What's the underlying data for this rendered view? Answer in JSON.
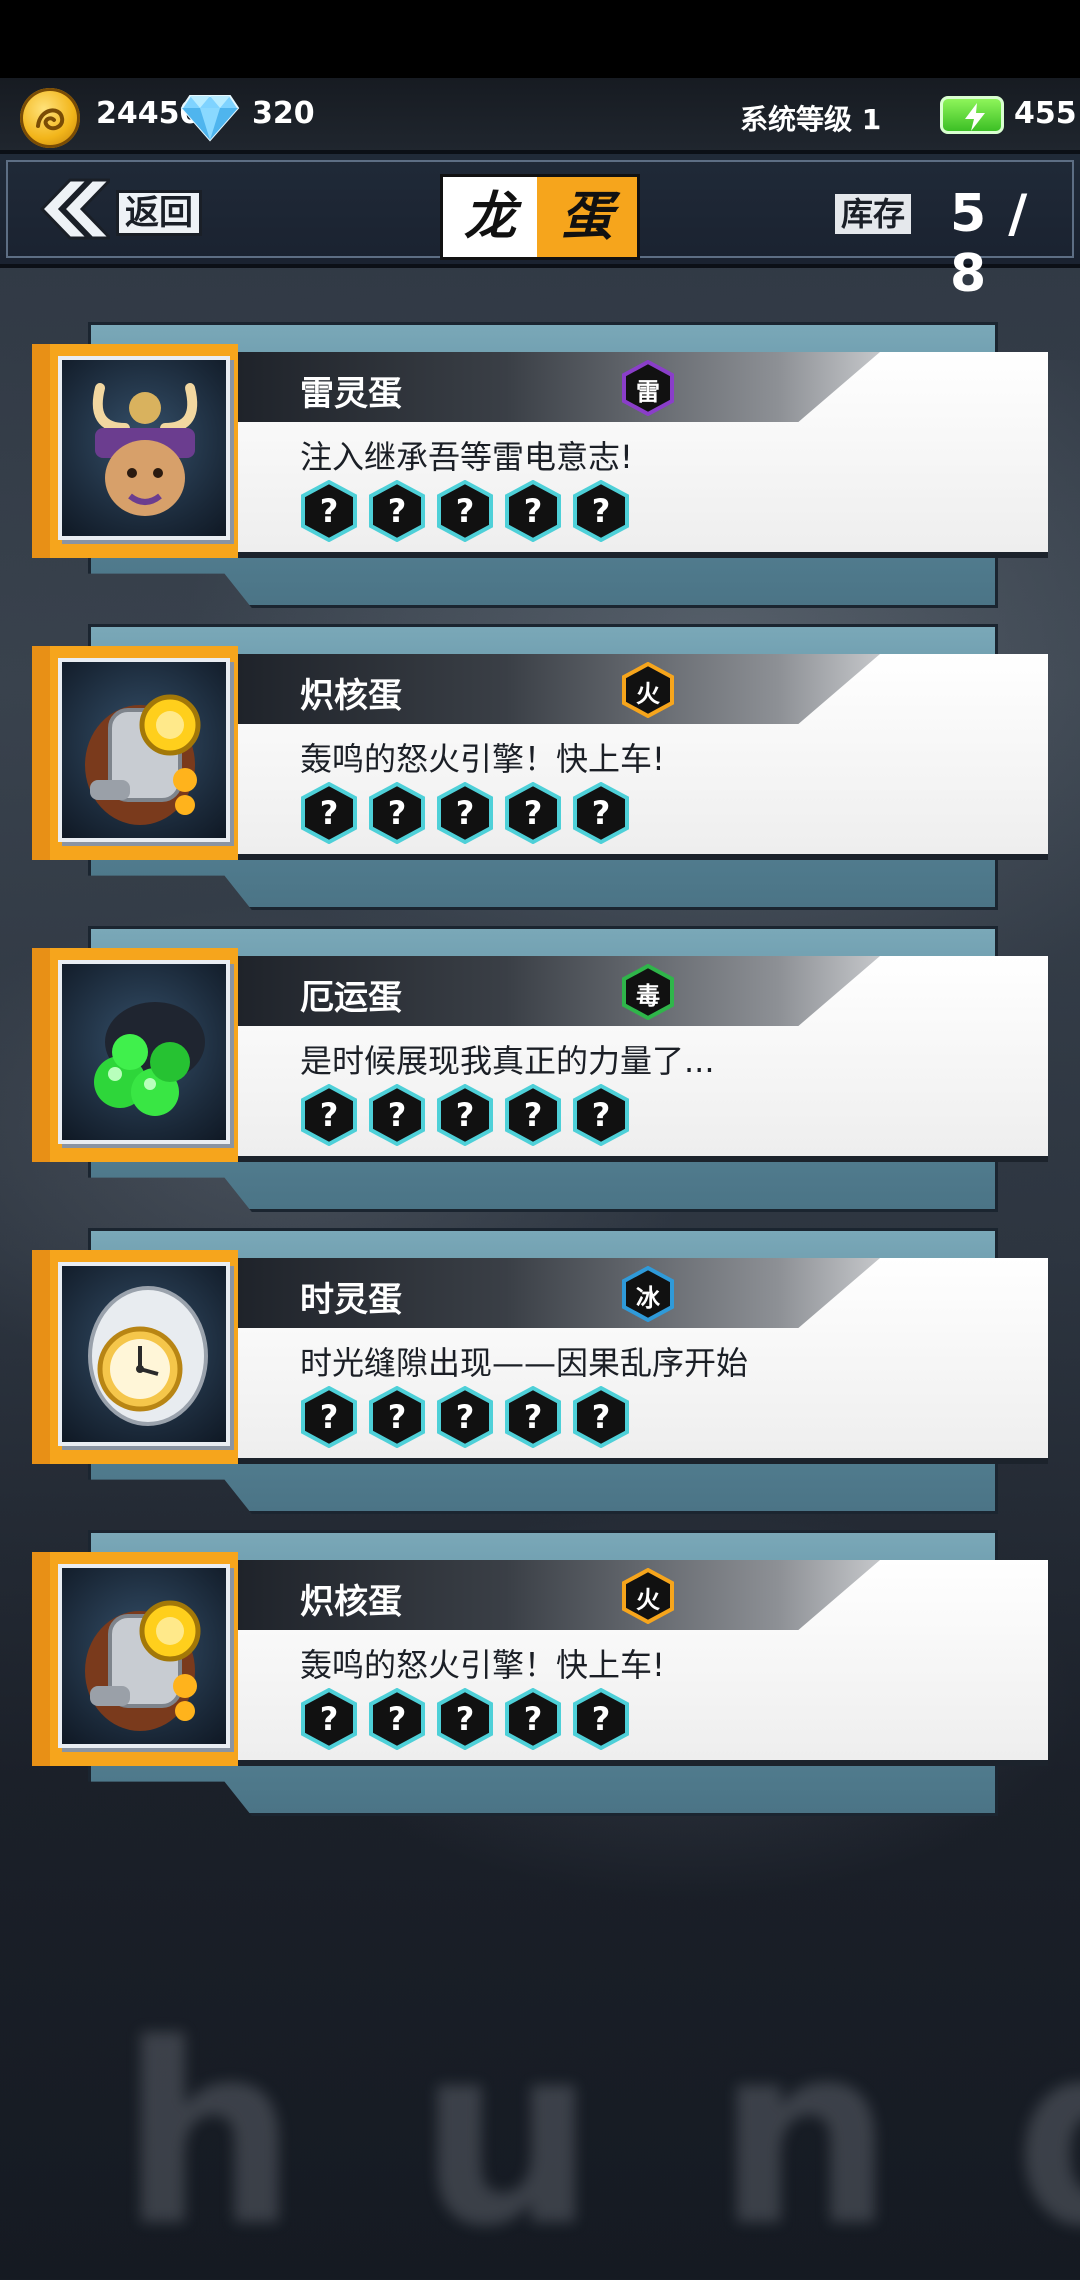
{
  "resources": {
    "coins": "24450",
    "gems": "320",
    "level": "系统等级 1",
    "energy": "455"
  },
  "header": {
    "back_label": "返回",
    "title_left": "龙",
    "title_right": "蛋",
    "stock_label": "库存",
    "stock_value": "5 / 8"
  },
  "eggs": [
    {
      "name": "雷灵蛋",
      "desc": "注入继承吾等雷电意志!",
      "element": "雷",
      "element_color": "#8a3ec9",
      "icon": "samurai-helmet-icon",
      "slots": [
        "?",
        "?",
        "?",
        "?",
        "?"
      ]
    },
    {
      "name": "炽核蛋",
      "desc": "轰鸣的怒火引擎！快上车!",
      "element": "火",
      "element_color": "#f6a51c",
      "icon": "engine-egg-icon",
      "slots": [
        "?",
        "?",
        "?",
        "?",
        "?"
      ]
    },
    {
      "name": "厄运蛋",
      "desc": "是时候展现我真正的力量了...",
      "element": "毒",
      "element_color": "#2fb54a",
      "icon": "slime-egg-icon",
      "slots": [
        "?",
        "?",
        "?",
        "?",
        "?"
      ]
    },
    {
      "name": "时灵蛋",
      "desc": "时光缝隙出现——因果乱序开始",
      "element": "冰",
      "element_color": "#2f9ad9",
      "icon": "clock-egg-icon",
      "slots": [
        "?",
        "?",
        "?",
        "?",
        "?"
      ]
    },
    {
      "name": "炽核蛋",
      "desc": "轰鸣的怒火引擎！快上车!",
      "element": "火",
      "element_color": "#f6a51c",
      "icon": "engine-egg-icon",
      "slots": [
        "?",
        "?",
        "?",
        "?",
        "?"
      ]
    }
  ],
  "background": {
    "watermark": "hundr"
  }
}
